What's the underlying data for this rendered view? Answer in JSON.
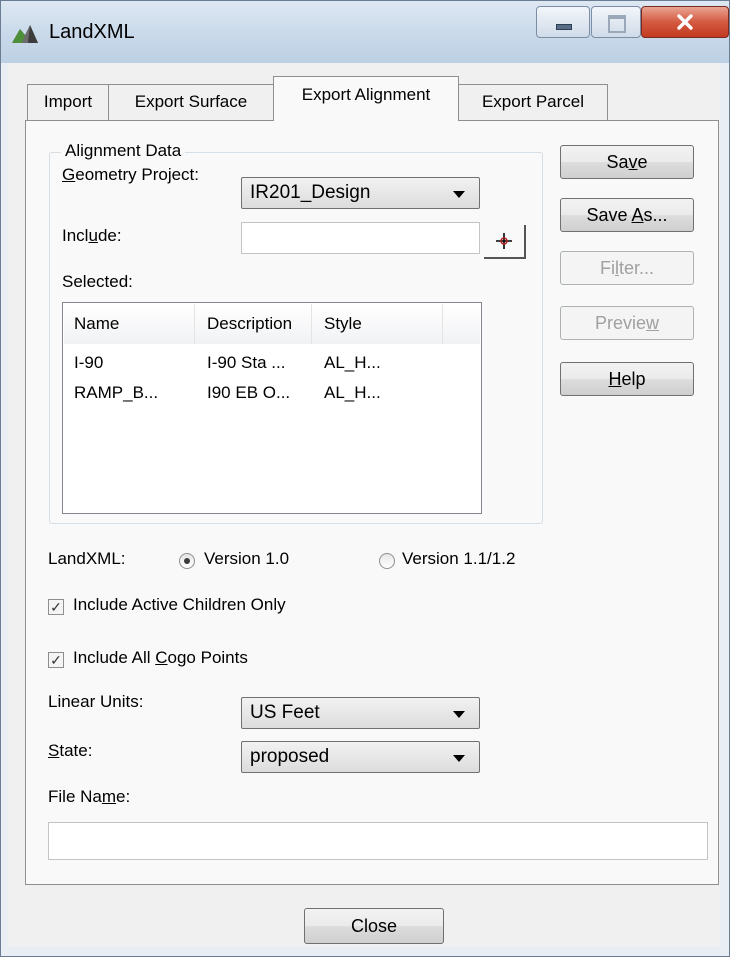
{
  "window": {
    "title": "LandXML"
  },
  "tabs": [
    {
      "label": "Import"
    },
    {
      "label": "Export Surface"
    },
    {
      "label": "Export Alignment"
    },
    {
      "label": "Export Parcel"
    }
  ],
  "alignment_data": {
    "group_title": "Alignment Data",
    "geometry_project_label_pre": "",
    "geometry_project_label_key": "G",
    "geometry_project_label_post": "eometry Project:",
    "geometry_project_value": "IR201_Design",
    "include_label_pre": "Incl",
    "include_label_key": "u",
    "include_label_post": "de:",
    "include_value": "",
    "selected_label": "Selected:",
    "columns": [
      "Name",
      "Description",
      "Style"
    ],
    "rows": [
      [
        "I-90",
        "I-90 Sta ...",
        "AL_H..."
      ],
      [
        "RAMP_B...",
        "I90 EB O...",
        "AL_H..."
      ]
    ]
  },
  "buttons": {
    "save_pre": "Sa",
    "save_key": "v",
    "save_post": "e",
    "save_as_pre": "Save ",
    "save_as_key": "A",
    "save_as_post": "s...",
    "filter_pre": "Fi",
    "filter_key": "l",
    "filter_post": "ter...",
    "preview_pre": "Previe",
    "preview_key": "w",
    "preview_post": "",
    "help_pre": "",
    "help_key": "H",
    "help_post": "elp",
    "close": "Close"
  },
  "landxml": {
    "label": "LandXML:",
    "version1": "Version 1.0",
    "version2": "Version 1.1/1.2",
    "selected_version": "Version 1.0"
  },
  "checkboxes": {
    "active_children": "Include Active Children Only",
    "cogo_pre": "Include All ",
    "cogo_key": "C",
    "cogo_post": "ogo Points",
    "active_children_checked": true,
    "cogo_checked": true
  },
  "units": {
    "linear_label": "Linear Units:",
    "linear_value": "US Feet",
    "state_key": "S",
    "state_post": "tate:",
    "state_value": "proposed",
    "file_name_pre": "File Na",
    "file_name_key": "m",
    "file_name_post": "e:",
    "file_name_value": ""
  }
}
